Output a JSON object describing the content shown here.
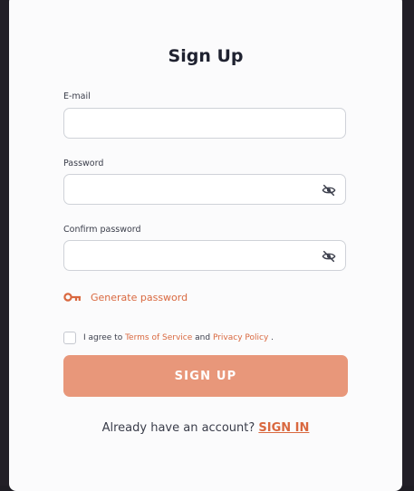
{
  "form": {
    "title": "Sign Up",
    "email": {
      "label": "E-mail",
      "value": "",
      "placeholder": ""
    },
    "password": {
      "label": "Password",
      "value": "",
      "placeholder": ""
    },
    "confirm_password": {
      "label": "Confirm password",
      "value": "",
      "placeholder": ""
    },
    "generate_password_label": "Generate password",
    "agree": {
      "prefix": "I agree to",
      "terms_link": "Terms of Service",
      "middle": "and",
      "privacy_link": "Privacy Policy",
      "suffix": ".",
      "checked": false
    },
    "submit_label": "SIGN UP"
  },
  "footer": {
    "question": "Already have an account?",
    "signin_label": "SIGN IN"
  },
  "icons": {
    "password_visibility": "eye-slash-icon",
    "generate": "key-icon"
  },
  "colors": {
    "accent": "#d9683f",
    "button": "#e8977a",
    "panel": "#fbfbfc",
    "background": "#221f27"
  }
}
